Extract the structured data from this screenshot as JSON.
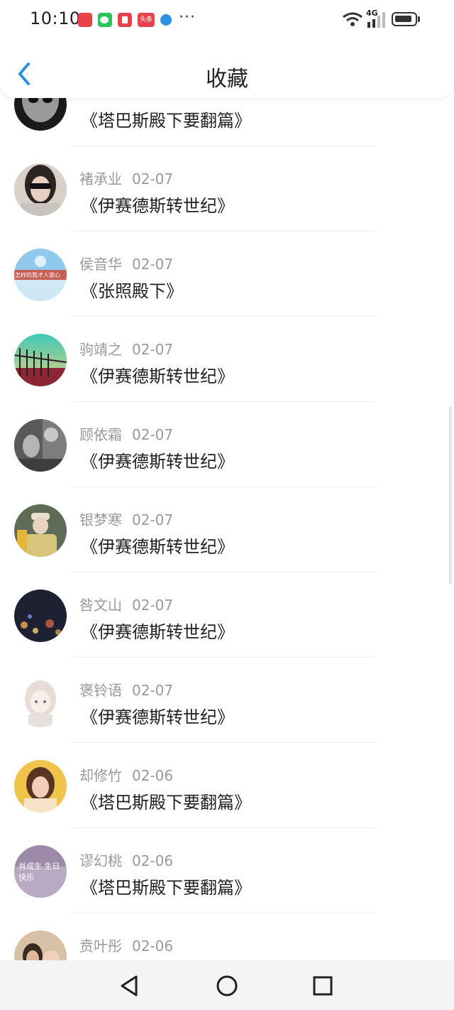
{
  "status_bar": {
    "time": "10:10",
    "notification_icons": [
      "news-app-icon",
      "wechat-icon",
      "red-app-icon",
      "toutiao-icon",
      "browser-icon"
    ],
    "notification_badge_text": "头条",
    "more": "···",
    "network": "4G"
  },
  "header": {
    "title": "收藏"
  },
  "items": [
    {
      "user": "",
      "date": "",
      "book": "《塔巴斯殿下要翻篇》"
    },
    {
      "user": "褚承业",
      "date": "02-07",
      "book": "《伊赛德斯转世纪》"
    },
    {
      "user": "侯音华",
      "date": "02-07",
      "book": "《张照殿下》"
    },
    {
      "user": "驹靖之",
      "date": "02-07",
      "book": "《伊赛德斯转世纪》"
    },
    {
      "user": "顾依霜",
      "date": "02-07",
      "book": "《伊赛德斯转世纪》"
    },
    {
      "user": "银梦寒",
      "date": "02-07",
      "book": "《伊赛德斯转世纪》"
    },
    {
      "user": "咎文山",
      "date": "02-07",
      "book": "《伊赛德斯转世纪》"
    },
    {
      "user": "褒铃语",
      "date": "02-07",
      "book": "《伊赛德斯转世纪》"
    },
    {
      "user": "却修竹",
      "date": "02-06",
      "book": "《塔巴斯殿下要翻篇》"
    },
    {
      "user": "谬幻桃",
      "date": "02-06",
      "book": "《塔巴斯殿下要翻篇》"
    },
    {
      "user": "贲叶彤",
      "date": "02-06",
      "book": ""
    }
  ],
  "avatar_texts": {
    "item2": "怎样的我才人欲心",
    "item9": "肖成生 生日快乐"
  },
  "colors": {
    "accent": "#2f8fe0",
    "text_primary": "#222222",
    "text_secondary": "#999999"
  }
}
